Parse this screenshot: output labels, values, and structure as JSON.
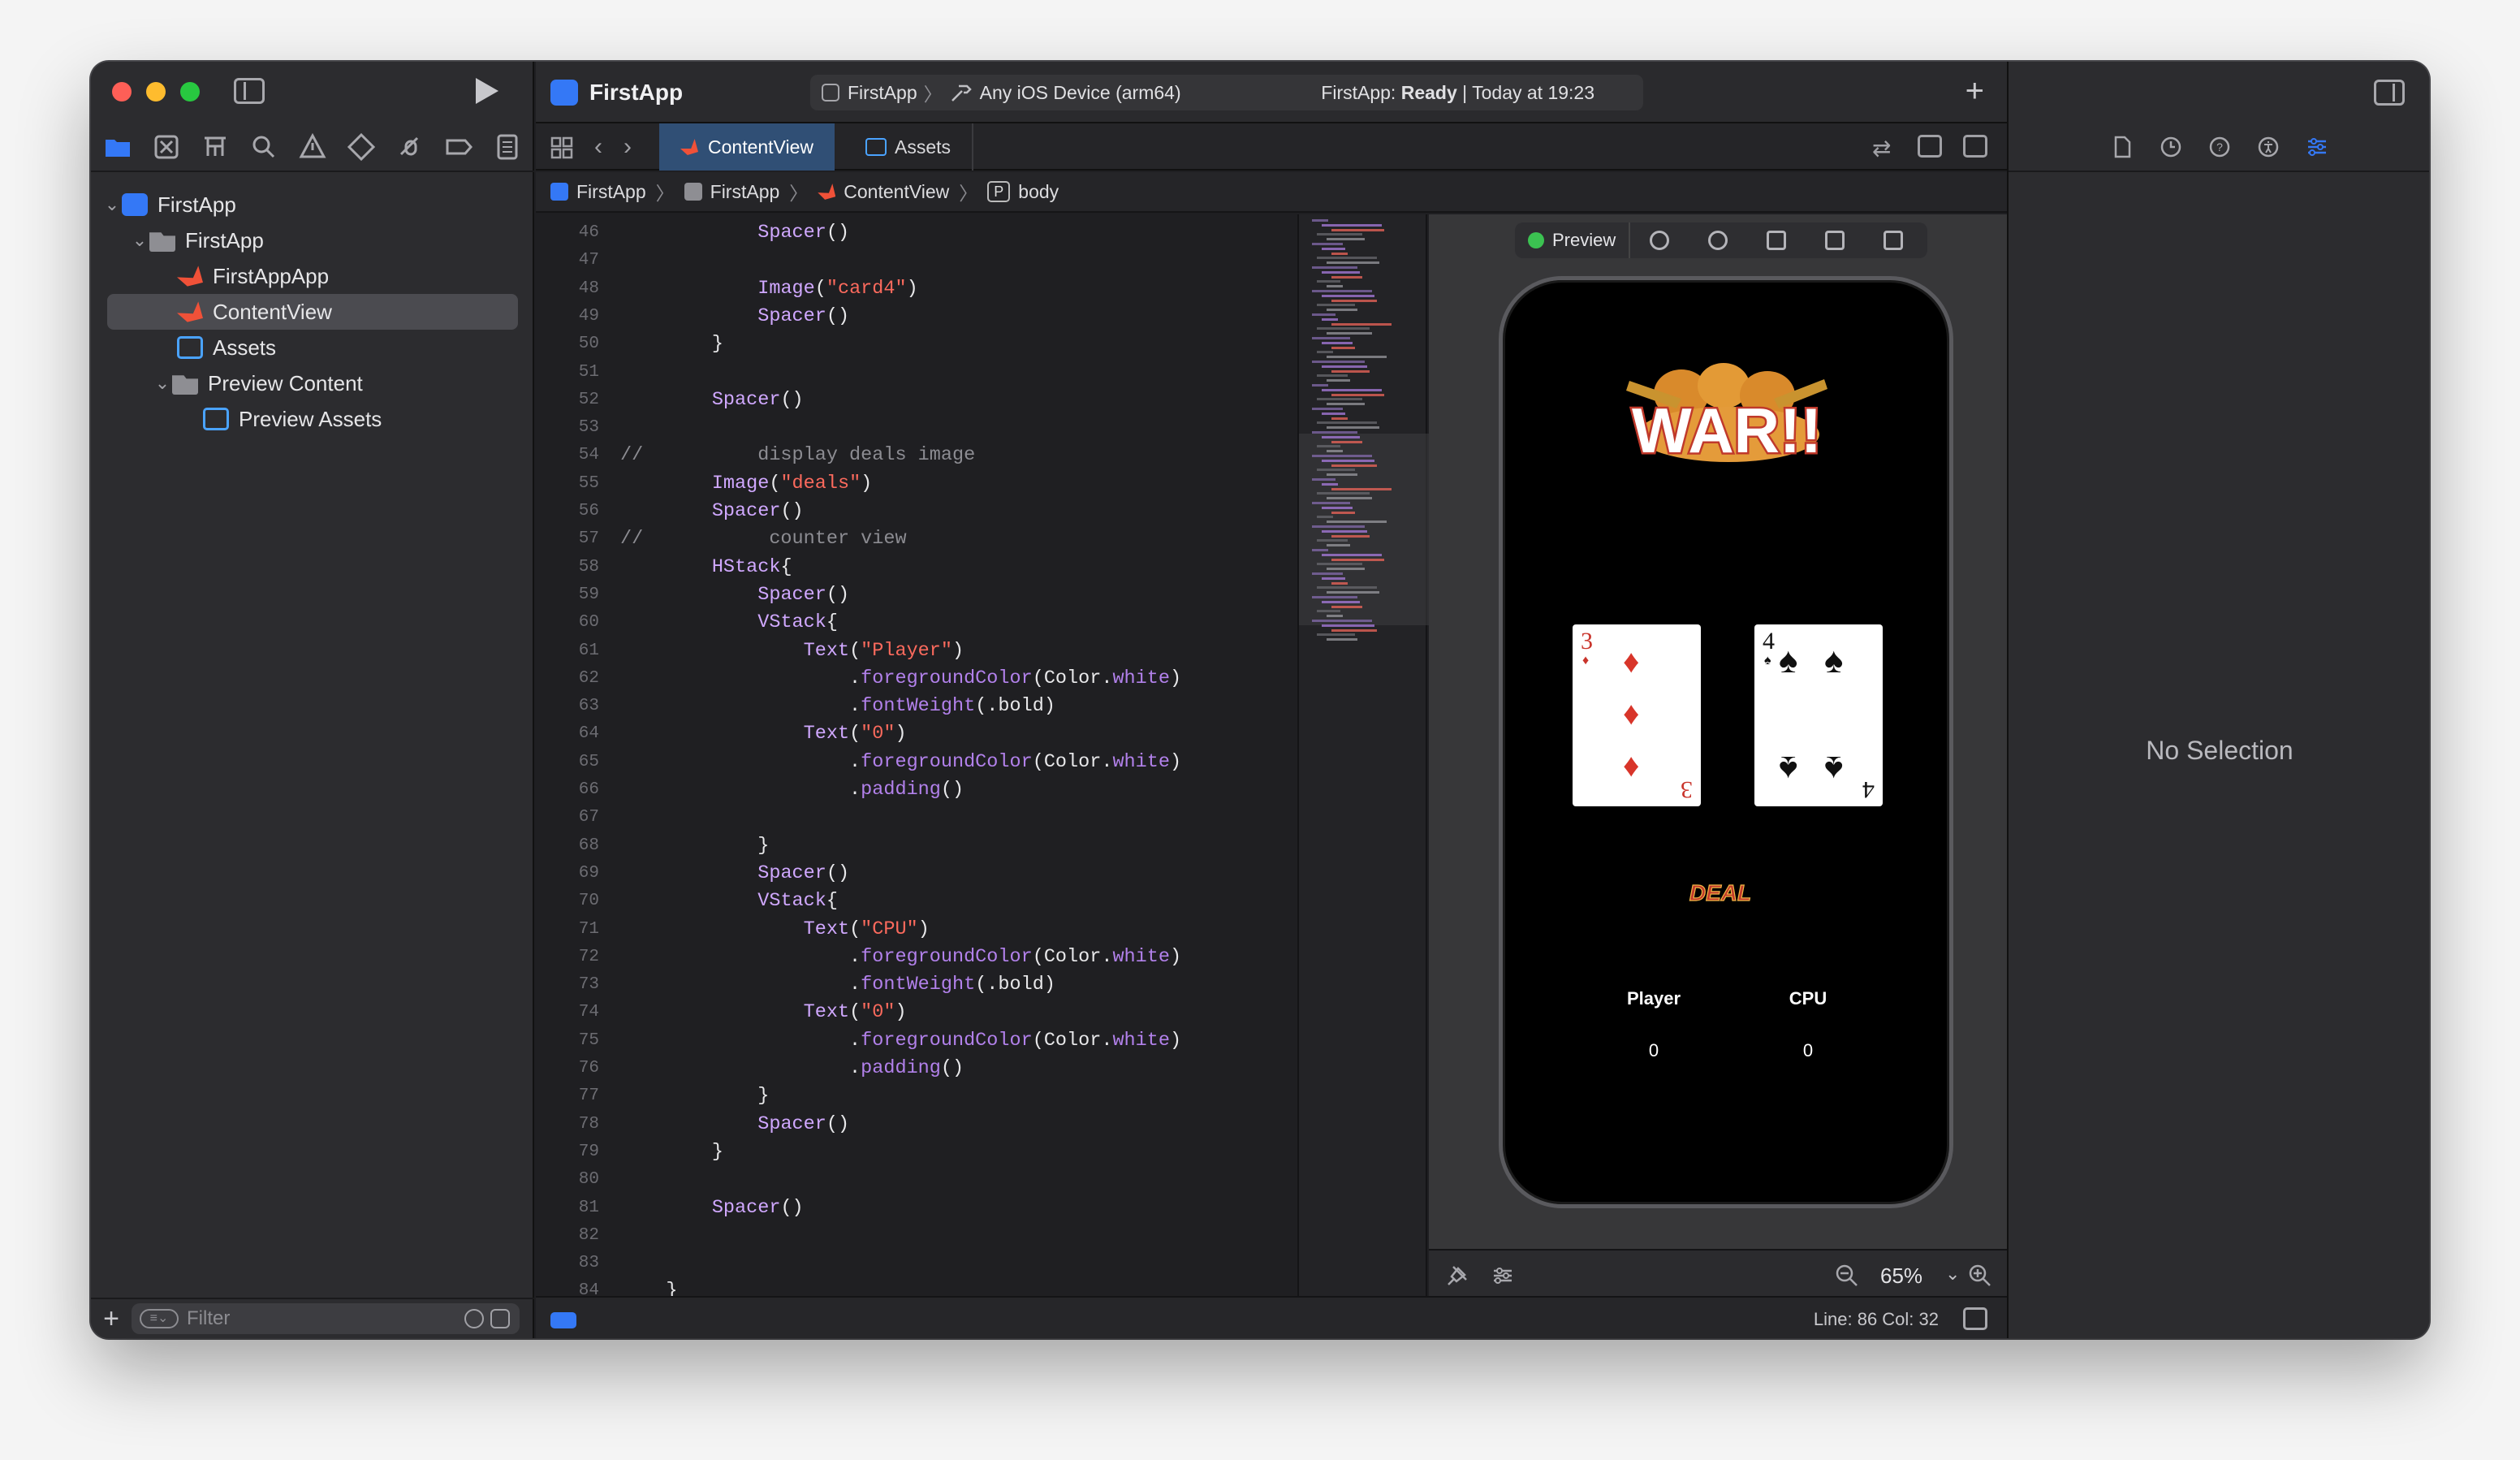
{
  "app": {
    "project_name": "FirstApp",
    "scheme_target": "FirstApp",
    "scheme_device": "Any iOS Device (arm64)",
    "status_prefix": "FirstApp:",
    "status_state": "Ready",
    "status_time": "| Today at 19:23"
  },
  "navigator": {
    "items": [
      {
        "label": "FirstApp",
        "kind": "project"
      },
      {
        "label": "FirstApp",
        "kind": "folder"
      },
      {
        "label": "FirstAppApp",
        "kind": "swift"
      },
      {
        "label": "ContentView",
        "kind": "swift",
        "selected": true
      },
      {
        "label": "Assets",
        "kind": "assets"
      },
      {
        "label": "Preview Content",
        "kind": "folder"
      },
      {
        "label": "Preview Assets",
        "kind": "assets"
      }
    ],
    "filter_placeholder": "Filter"
  },
  "tabs": [
    {
      "label": "ContentView",
      "active": true
    },
    {
      "label": "Assets",
      "active": false
    }
  ],
  "jumpbar": [
    "FirstApp",
    "FirstApp",
    "ContentView",
    "body"
  ],
  "code_lines": [
    {
      "n": "46",
      "text": "            Spacer()"
    },
    {
      "n": "47",
      "text": ""
    },
    {
      "n": "48",
      "text": "            Image(\"card4\")"
    },
    {
      "n": "49",
      "text": "            Spacer()"
    },
    {
      "n": "50",
      "text": "        }"
    },
    {
      "n": "51",
      "text": ""
    },
    {
      "n": "52",
      "text": "        Spacer()"
    },
    {
      "n": "53",
      "text": ""
    },
    {
      "n": "54",
      "text": "//          display deals image"
    },
    {
      "n": "55",
      "text": "        Image(\"deals\")"
    },
    {
      "n": "56",
      "text": "        Spacer()"
    },
    {
      "n": "57",
      "text": "//           counter view"
    },
    {
      "n": "58",
      "text": "        HStack{"
    },
    {
      "n": "59",
      "text": "            Spacer()"
    },
    {
      "n": "60",
      "text": "            VStack{"
    },
    {
      "n": "61",
      "text": "                Text(\"Player\")"
    },
    {
      "n": "62",
      "text": "                    .foregroundColor(Color.white)"
    },
    {
      "n": "63",
      "text": "                    .fontWeight(.bold)"
    },
    {
      "n": "64",
      "text": "                Text(\"0\")"
    },
    {
      "n": "65",
      "text": "                    .foregroundColor(Color.white)"
    },
    {
      "n": "66",
      "text": "                    .padding()"
    },
    {
      "n": "67",
      "text": ""
    },
    {
      "n": "68",
      "text": "            }"
    },
    {
      "n": "69",
      "text": "            Spacer()"
    },
    {
      "n": "70",
      "text": "            VStack{"
    },
    {
      "n": "71",
      "text": "                Text(\"CPU\")"
    },
    {
      "n": "72",
      "text": "                    .foregroundColor(Color.white)"
    },
    {
      "n": "73",
      "text": "                    .fontWeight(.bold)"
    },
    {
      "n": "74",
      "text": "                Text(\"0\")"
    },
    {
      "n": "75",
      "text": "                    .foregroundColor(Color.white)"
    },
    {
      "n": "76",
      "text": "                    .padding()"
    },
    {
      "n": "77",
      "text": "            }"
    },
    {
      "n": "78",
      "text": "            Spacer()"
    },
    {
      "n": "79",
      "text": "        }"
    },
    {
      "n": "80",
      "text": ""
    },
    {
      "n": "81",
      "text": "        Spacer()"
    },
    {
      "n": "82",
      "text": ""
    },
    {
      "n": "83",
      "text": ""
    },
    {
      "n": "84",
      "text": "    }"
    }
  ],
  "preview": {
    "label": "Preview",
    "logo_text": "WAR!!",
    "deal_text": "DEAL",
    "card_left": {
      "rank": "3",
      "suit": "♦"
    },
    "card_right": {
      "rank": "4",
      "suit": "♠"
    },
    "player_label": "Player",
    "cpu_label": "CPU",
    "player_score": "0",
    "cpu_score": "0",
    "zoom": "65%"
  },
  "statusbar": {
    "position": "Line: 86  Col: 32"
  },
  "inspector": {
    "empty_text": "No Selection"
  },
  "colors": {
    "accent": "#3478f6",
    "tab_active": "#304f75",
    "string": "#fc6a5d",
    "method": "#b281eb",
    "ready": "#3bc251"
  }
}
